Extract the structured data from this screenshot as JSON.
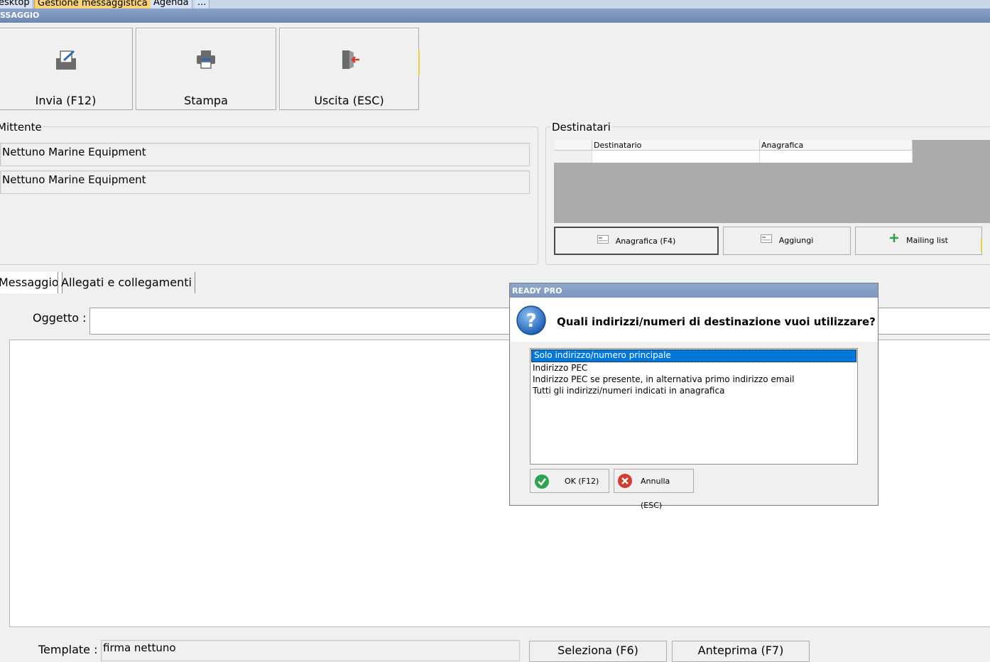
{
  "tabbar": {
    "tabs": [
      {
        "label": "esktop"
      },
      {
        "label": "Gestione messaggistica"
      },
      {
        "label": "Agenda"
      },
      {
        "label": "..."
      }
    ]
  },
  "window": {
    "title": "SSAGGIO"
  },
  "toolbar": {
    "send_label": "Invia (F12)",
    "print_label": "Stampa",
    "exit_label": "Uscita (ESC)"
  },
  "sender": {
    "legend": "Mittente",
    "name_value": "Nettuno Marine Equipment",
    "email_value": "Nettuno Marine Equipment"
  },
  "recipients": {
    "legend": "Destinatari",
    "columns": [
      "Destinatario",
      "Anagrafica"
    ],
    "buttons": {
      "registry": "Anagrafica (F4)",
      "add": "Aggiungi",
      "mailing": "Mailing list"
    }
  },
  "tabs": {
    "message": "Messaggio",
    "attachments": "Allegati e collegamenti"
  },
  "message": {
    "subject_label": "Oggetto :",
    "subject_value": "",
    "template_label": "Template :",
    "template_value": "firma nettuno",
    "select_label": "Seleziona (F6)",
    "preview_label": "Anteprima (F7)"
  },
  "dialog": {
    "title": "READY PRO",
    "question": "Quali indirizzi/numeri di destinazione vuoi utilizzare?",
    "options": [
      "Solo indirizzo/numero principale",
      "Indirizzo PEC",
      "Indirizzo PEC se presente, in alternativa primo indirizzo email",
      "Tutti gli indirizzi/numeri indicati in anagrafica"
    ],
    "selected_index": 0,
    "ok_label": "OK (F12)",
    "cancel_label": "Annulla (ESC)"
  },
  "colors": {
    "selection": "#0078d7",
    "title_bar": "#7e96bb",
    "active_tab": "#f7d27a"
  }
}
